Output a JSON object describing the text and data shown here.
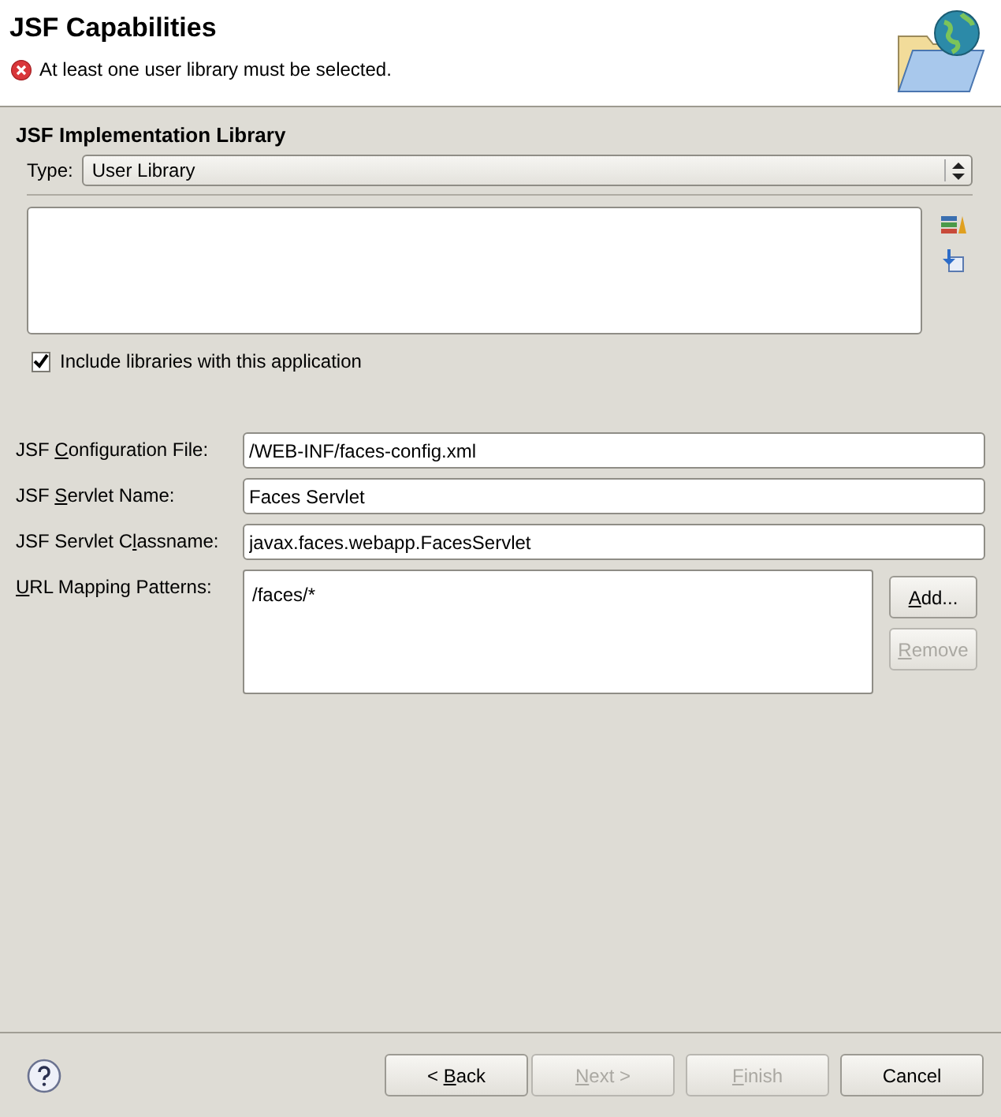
{
  "header": {
    "title": "JSF Capabilities",
    "message": "At least one user library must be selected.",
    "error": true
  },
  "implementation": {
    "heading": "JSF Implementation Library",
    "type_label": "Type:",
    "type_value": "User Library",
    "include": {
      "label": "Include libraries with this application",
      "checked": true
    }
  },
  "fields": [
    {
      "label": {
        "before": "JSF ",
        "key": "C",
        "after": "onfiguration File:"
      },
      "value": "/WEB-INF/faces-config.xml"
    },
    {
      "label": {
        "before": "JSF ",
        "key": "S",
        "after": "ervlet Name:"
      },
      "value": "Faces Servlet"
    },
    {
      "label": {
        "before": "JSF Servlet C",
        "key": "l",
        "after": "assname:"
      },
      "value": "javax.faces.webapp.FacesServlet"
    }
  ],
  "url_patterns": {
    "label": {
      "key": "U",
      "after": "RL Mapping Patterns:"
    },
    "items": [
      "/faces/*"
    ],
    "buttons": [
      {
        "label": {
          "key": "A",
          "after": "dd..."
        },
        "disabled": false
      },
      {
        "label": {
          "key": "R",
          "after": "emove"
        },
        "disabled": true
      }
    ]
  },
  "footer": {
    "buttons": [
      {
        "label": {
          "before": "< ",
          "key": "B",
          "after": "ack"
        },
        "disabled": false
      },
      {
        "label": {
          "key": "N",
          "after": "ext >"
        },
        "disabled": true
      },
      {
        "label": {
          "key": "F",
          "after": "inish"
        },
        "disabled": true
      },
      {
        "label": {
          "after": "Cancel"
        },
        "disabled": false
      }
    ]
  }
}
